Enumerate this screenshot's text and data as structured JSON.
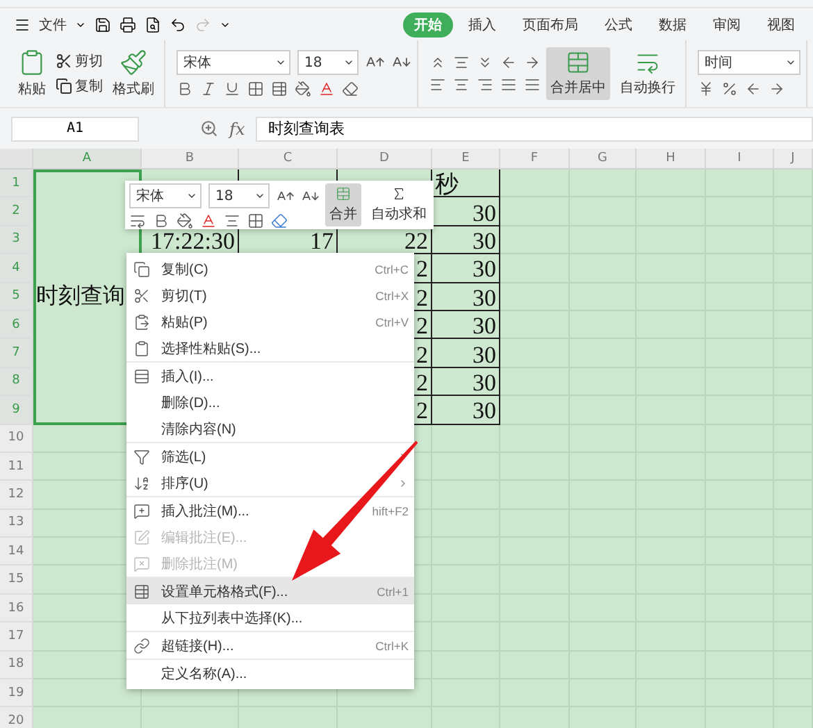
{
  "menu_bar": {
    "menu_label": "文件",
    "tabs": [
      {
        "label": "开始",
        "selected": true
      },
      {
        "label": "插入",
        "selected": false
      },
      {
        "label": "页面布局",
        "selected": false
      },
      {
        "label": "公式",
        "selected": false
      },
      {
        "label": "数据",
        "selected": false
      },
      {
        "label": "审阅",
        "selected": false
      },
      {
        "label": "视图",
        "selected": false
      }
    ]
  },
  "ribbon": {
    "paste": "粘贴",
    "cut": "剪切",
    "copy": "复制",
    "format_painter": "格式刷",
    "font": "宋体",
    "size": "18",
    "merge": "合并居中",
    "wrap": "自动换行",
    "number_format": "时间"
  },
  "formula_bar": {
    "cell": "A1",
    "fx": "fx",
    "value": "时刻查询表"
  },
  "columns": [
    {
      "label": "A",
      "selected": true
    },
    {
      "label": "B",
      "selected": false
    },
    {
      "label": "C",
      "selected": false
    },
    {
      "label": "D",
      "selected": false
    },
    {
      "label": "E",
      "selected": false
    },
    {
      "label": "F",
      "selected": false
    },
    {
      "label": "G",
      "selected": false
    },
    {
      "label": "H",
      "selected": false
    },
    {
      "label": "I",
      "selected": false
    },
    {
      "label": "J",
      "selected": false
    }
  ],
  "merged_cell": {
    "text": "时刻查询"
  },
  "rows": [
    {
      "label": "1",
      "selected": true,
      "cells": {
        "E": "秒"
      }
    },
    {
      "label": "2",
      "selected": true,
      "cells": {
        "E": "30"
      }
    },
    {
      "label": "3",
      "selected": true,
      "cells": {
        "B": "17:22:30",
        "C": "17",
        "D": "22",
        "E": "30"
      }
    },
    {
      "label": "4",
      "selected": true,
      "cells": {
        "D": "2",
        "E": "30"
      }
    },
    {
      "label": "5",
      "selected": true,
      "cells": {
        "D": "2",
        "E": "30"
      }
    },
    {
      "label": "6",
      "selected": true,
      "cells": {
        "D": "2",
        "E": "30"
      }
    },
    {
      "label": "7",
      "selected": true,
      "cells": {
        "D": "2",
        "E": "30"
      }
    },
    {
      "label": "8",
      "selected": true,
      "cells": {
        "D": "2",
        "E": "30"
      }
    },
    {
      "label": "9",
      "selected": true,
      "cells": {
        "D": "2",
        "E": "30"
      }
    },
    {
      "label": "10",
      "selected": false,
      "cells": {}
    },
    {
      "label": "11",
      "selected": false,
      "cells": {}
    },
    {
      "label": "12",
      "selected": false,
      "cells": {}
    },
    {
      "label": "13",
      "selected": false,
      "cells": {}
    },
    {
      "label": "14",
      "selected": false,
      "cells": {}
    },
    {
      "label": "15",
      "selected": false,
      "cells": {}
    },
    {
      "label": "16",
      "selected": false,
      "cells": {}
    },
    {
      "label": "17",
      "selected": false,
      "cells": {}
    },
    {
      "label": "18",
      "selected": false,
      "cells": {}
    },
    {
      "label": "19",
      "selected": false,
      "cells": {}
    },
    {
      "label": "20",
      "selected": false,
      "cells": {}
    }
  ],
  "mini_toolbar": {
    "font": "宋体",
    "size": "18",
    "merge": "合并",
    "autosum": "自动求和"
  },
  "context_menu": {
    "sections": [
      [
        {
          "label": "复制(C)",
          "shortcut": "Ctrl+C",
          "disabled": false,
          "selected": false
        },
        {
          "label": "剪切(T)",
          "shortcut": "Ctrl+X",
          "disabled": false,
          "selected": false
        },
        {
          "label": "粘贴(P)",
          "shortcut": "Ctrl+V",
          "disabled": false,
          "selected": false
        },
        {
          "label": "选择性粘贴(S)...",
          "disabled": false,
          "selected": false
        }
      ],
      [
        {
          "label": "插入(I)...",
          "disabled": false,
          "selected": false
        },
        {
          "label": "删除(D)...",
          "disabled": false,
          "selected": false
        },
        {
          "label": "清除内容(N)",
          "disabled": false,
          "selected": false
        }
      ],
      [
        {
          "label": "筛选(L)",
          "submenu": true,
          "disabled": false,
          "selected": false
        },
        {
          "label": "排序(U)",
          "submenu": true,
          "disabled": false,
          "selected": false
        }
      ],
      [
        {
          "label": "插入批注(M)...",
          "shortcut": "hift+F2",
          "disabled": false,
          "selected": false
        },
        {
          "label": "编辑批注(E)...",
          "disabled": true,
          "selected": false
        },
        {
          "label": "删除批注(M)",
          "disabled": true,
          "selected": false
        }
      ],
      [
        {
          "label": "设置单元格格式(F)...",
          "shortcut": "Ctrl+1",
          "disabled": false,
          "selected": true
        },
        {
          "label": "从下拉列表中选择(K)...",
          "disabled": false,
          "selected": false
        }
      ],
      [
        {
          "label": "超链接(H)...",
          "shortcut": "Ctrl+K",
          "disabled": false,
          "selected": false
        }
      ],
      [
        {
          "label": "定义名称(A)...",
          "disabled": false,
          "selected": false
        }
      ]
    ]
  }
}
